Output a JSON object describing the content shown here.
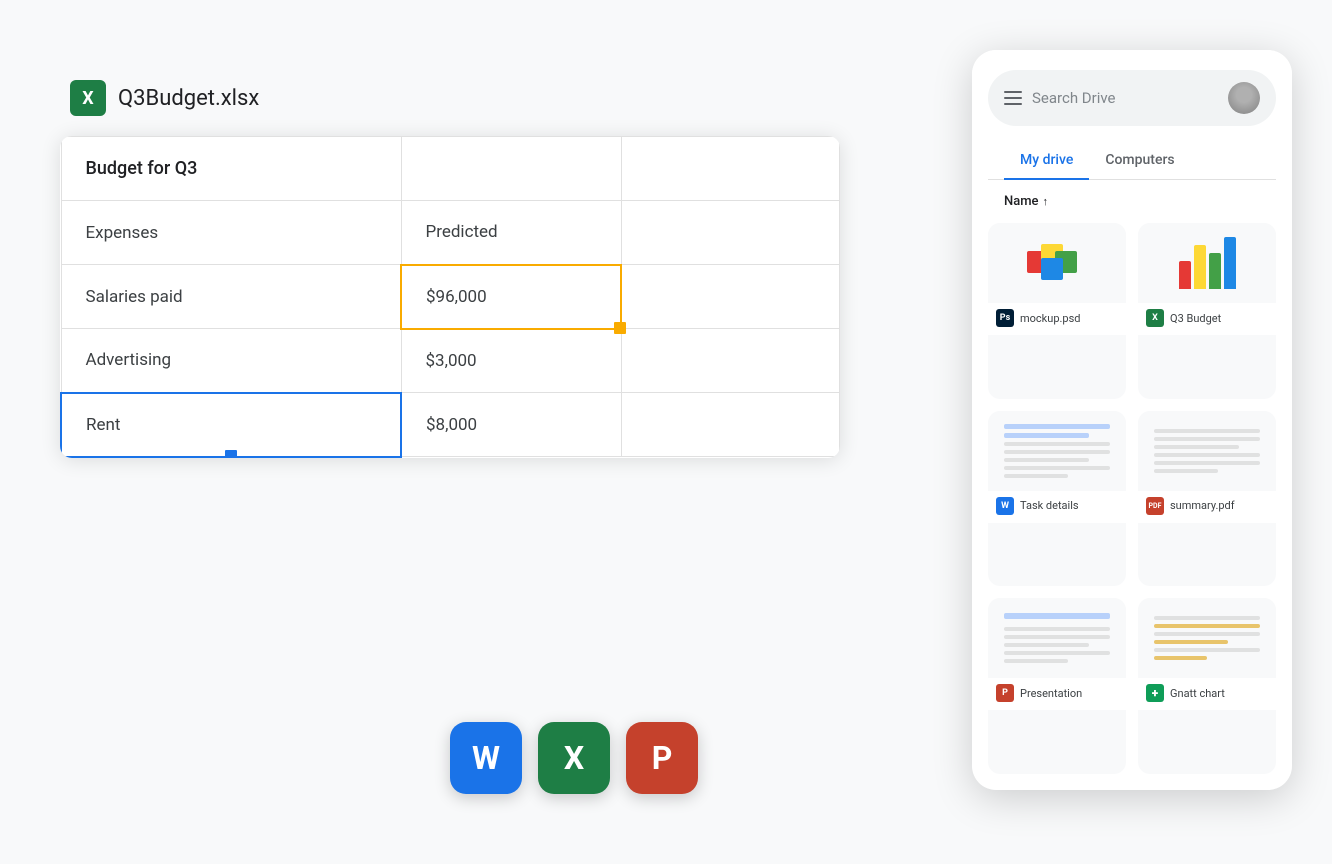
{
  "spreadsheet": {
    "filename": "Q3Budget.xlsx",
    "icon_label": "X",
    "table": {
      "header": {
        "col1": "Budget for Q3",
        "col2": "",
        "col3": ""
      },
      "subheader": {
        "col1": "Expenses",
        "col2": "Predicted",
        "col3": ""
      },
      "rows": [
        {
          "label": "Salaries paid",
          "value": "$96,000",
          "highlighted": "yellow"
        },
        {
          "label": "Advertising",
          "value": "$3,000",
          "highlighted": ""
        },
        {
          "label": "Rent",
          "value": "$8,000",
          "highlighted": "blue"
        }
      ]
    }
  },
  "app_icons": [
    {
      "letter": "W",
      "name": "word",
      "color_class": "app-icon-word"
    },
    {
      "letter": "X",
      "name": "excel",
      "color_class": "app-icon-excel2"
    },
    {
      "letter": "P",
      "name": "powerpoint",
      "color_class": "app-icon-ppt"
    }
  ],
  "drive": {
    "search_placeholder": "Search Drive",
    "tabs": [
      {
        "label": "My drive",
        "active": true
      },
      {
        "label": "Computers",
        "active": false
      }
    ],
    "name_header": "Name",
    "sort_arrow": "↑",
    "items": [
      {
        "name": "mockup.psd",
        "badge": "Ps",
        "badge_class": "badge-ps",
        "type": "psd"
      },
      {
        "name": "Q3 Budget",
        "badge": "X",
        "badge_class": "badge-xl",
        "type": "chart"
      },
      {
        "name": "Task details",
        "badge": "W",
        "badge_class": "badge-w",
        "type": "doc"
      },
      {
        "name": "summary.pdf",
        "badge": "PDF",
        "badge_class": "badge-pdf",
        "type": "doc"
      },
      {
        "name": "Presentation",
        "badge": "P",
        "badge_class": "badge-p",
        "type": "doc"
      },
      {
        "name": "Gnatt chart",
        "badge": "+",
        "badge_class": "badge-sheets",
        "type": "doc"
      }
    ]
  }
}
